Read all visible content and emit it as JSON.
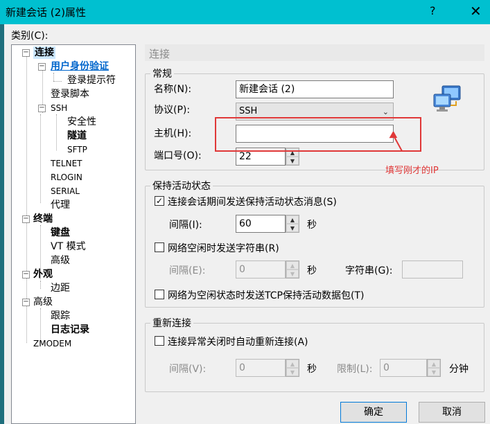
{
  "window": {
    "title": "新建会话 (2)属性",
    "help_glyph": "?",
    "close_glyph": "✕"
  },
  "category_label": "类别(C):",
  "tree": {
    "connection": "连接",
    "user_auth": "用户身份验证",
    "login_prompt": "登录提示符",
    "login_script": "登录脚本",
    "ssh": "SSH",
    "security": "安全性",
    "tunnel": "隧道",
    "sftp": "SFTP",
    "telnet": "TELNET",
    "rlogin": "RLOGIN",
    "serial": "SERIAL",
    "proxy": "代理",
    "terminal": "终端",
    "keyboard": "键盘",
    "vt_mode": "VT 模式",
    "advanced1": "高级",
    "appearance": "外观",
    "margin": "边距",
    "advanced2": "高级",
    "trace": "跟踪",
    "log": "日志记录",
    "zmodem": "ZMODEM"
  },
  "section_title": "连接",
  "general": {
    "legend": "常规",
    "name_label": "名称(N):",
    "name_value": "新建会话 (2)",
    "protocol_label": "协议(P):",
    "protocol_value": "SSH",
    "host_label": "主机(H):",
    "host_value": "",
    "port_label": "端口号(O):",
    "port_value": "22"
  },
  "keepalive": {
    "legend": "保持活动状态",
    "send_msg_label": "连接会话期间发送保持活动状态消息(S)",
    "send_msg_checked": true,
    "interval_label": "间隔(I):",
    "interval_value": "60",
    "interval_unit": "秒",
    "send_str_label": "网络空闲时发送字符串(R)",
    "send_str_checked": false,
    "interval2_label": "间隔(E):",
    "interval2_value": "0",
    "interval2_unit": "秒",
    "string_label": "字符串(G):",
    "tcp_label": "网络为空闲状态时发送TCP保持活动数据包(T)",
    "tcp_checked": false
  },
  "reconnect": {
    "legend": "重新连接",
    "auto_label": "连接异常关闭时自动重新连接(A)",
    "auto_checked": false,
    "interval_label": "间隔(V):",
    "interval_value": "0",
    "interval_unit": "秒",
    "limit_label": "限制(L):",
    "limit_value": "0",
    "limit_unit": "分钟"
  },
  "annotation": "填写刚才的IP",
  "buttons": {
    "ok": "确定",
    "cancel": "取消"
  },
  "colors": {
    "titlebar": "#00c0d0",
    "annotation": "#e03838",
    "selected": "#0066cc"
  }
}
